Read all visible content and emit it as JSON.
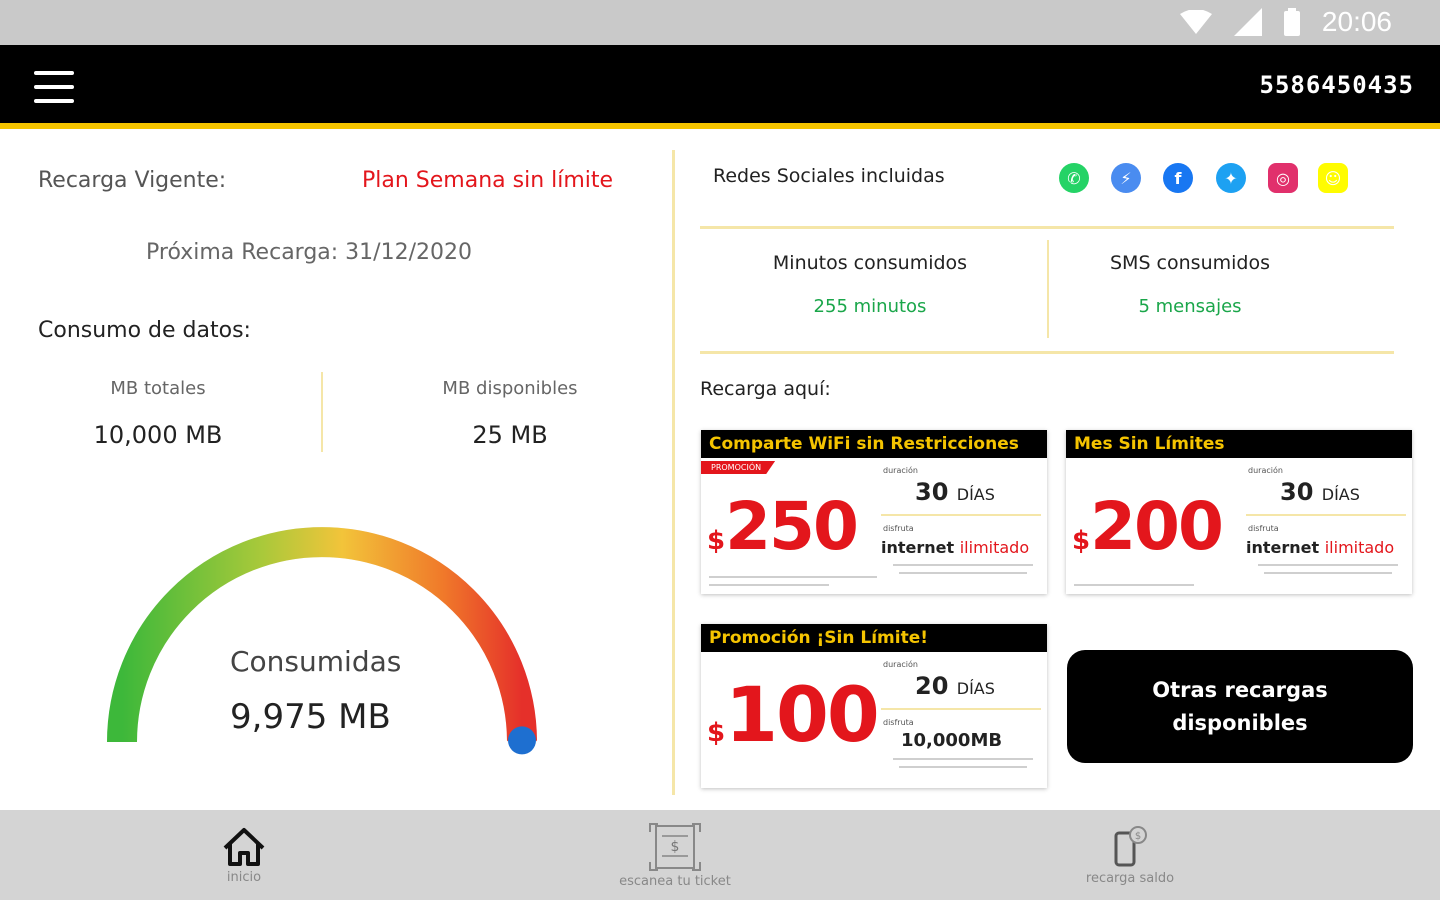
{
  "status_bar": {
    "time": "20:06",
    "icons": [
      "wifi-icon",
      "signal-icon",
      "battery-icon"
    ]
  },
  "top_bar": {
    "menu_icon": "hamburger-menu-icon",
    "phone_number": "5586450435"
  },
  "plan": {
    "label": "Recarga Vigente:",
    "name": "Plan Semana sin límite",
    "next_recharge": "Próxima Recarga: 31/12/2020"
  },
  "data_usage": {
    "title": "Consumo de datos:",
    "total_label": "MB totales",
    "total_value": "10,000 MB",
    "available_label": "MB disponibles",
    "available_value": "25 MB",
    "gauge_label": "Consumidas",
    "gauge_value": "9,975 MB",
    "used_fraction": 0.9975
  },
  "social": {
    "title": "Redes Sociales incluidas",
    "networks": [
      "whatsapp-icon",
      "messenger-icon",
      "facebook-icon",
      "twitter-icon",
      "instagram-icon",
      "snapchat-icon"
    ]
  },
  "usage": {
    "minutes_label": "Minutos consumidos",
    "minutes_value": "255 minutos",
    "sms_label": "SMS consumidos",
    "sms_value": "5 mensajes"
  },
  "recharge": {
    "title": "Recarga aquí:",
    "cards": [
      {
        "title": "Comparte WiFi sin Restricciones",
        "tag": "PROMOCIÓN",
        "currency": "$",
        "price": "250",
        "duration_label": "duración",
        "duration": "30",
        "duration_unit": "DÍAS",
        "benefit_label": "disfruta",
        "benefit": "internet",
        "benefit_accent": "ilimitado"
      },
      {
        "title": "Mes Sin Límites",
        "currency": "$",
        "price": "200",
        "duration_label": "duración",
        "duration": "30",
        "duration_unit": "DÍAS",
        "benefit_label": "disfruta",
        "benefit": "internet",
        "benefit_accent": "ilimitado"
      },
      {
        "title": "Promoción ¡Sin Límite!",
        "currency": "$",
        "price": "100",
        "duration_label": "duración",
        "duration": "20",
        "duration_unit": "DÍAS",
        "benefit_label": "disfruta",
        "benefit": "10,000MB"
      }
    ],
    "other_button_line1": "Otras recargas",
    "other_button_line2": "disponibles"
  },
  "bottom_nav": [
    {
      "label": "inicio",
      "icon": "home-icon"
    },
    {
      "label": "escanea tu ticket",
      "icon": "scan-ticket-icon"
    },
    {
      "label": "recarga saldo",
      "icon": "phone-recharge-icon"
    }
  ],
  "colors": {
    "accent_yellow": "#f5c400",
    "brand_red": "#e3161c",
    "green": "#1aa64a",
    "black": "#000000"
  }
}
